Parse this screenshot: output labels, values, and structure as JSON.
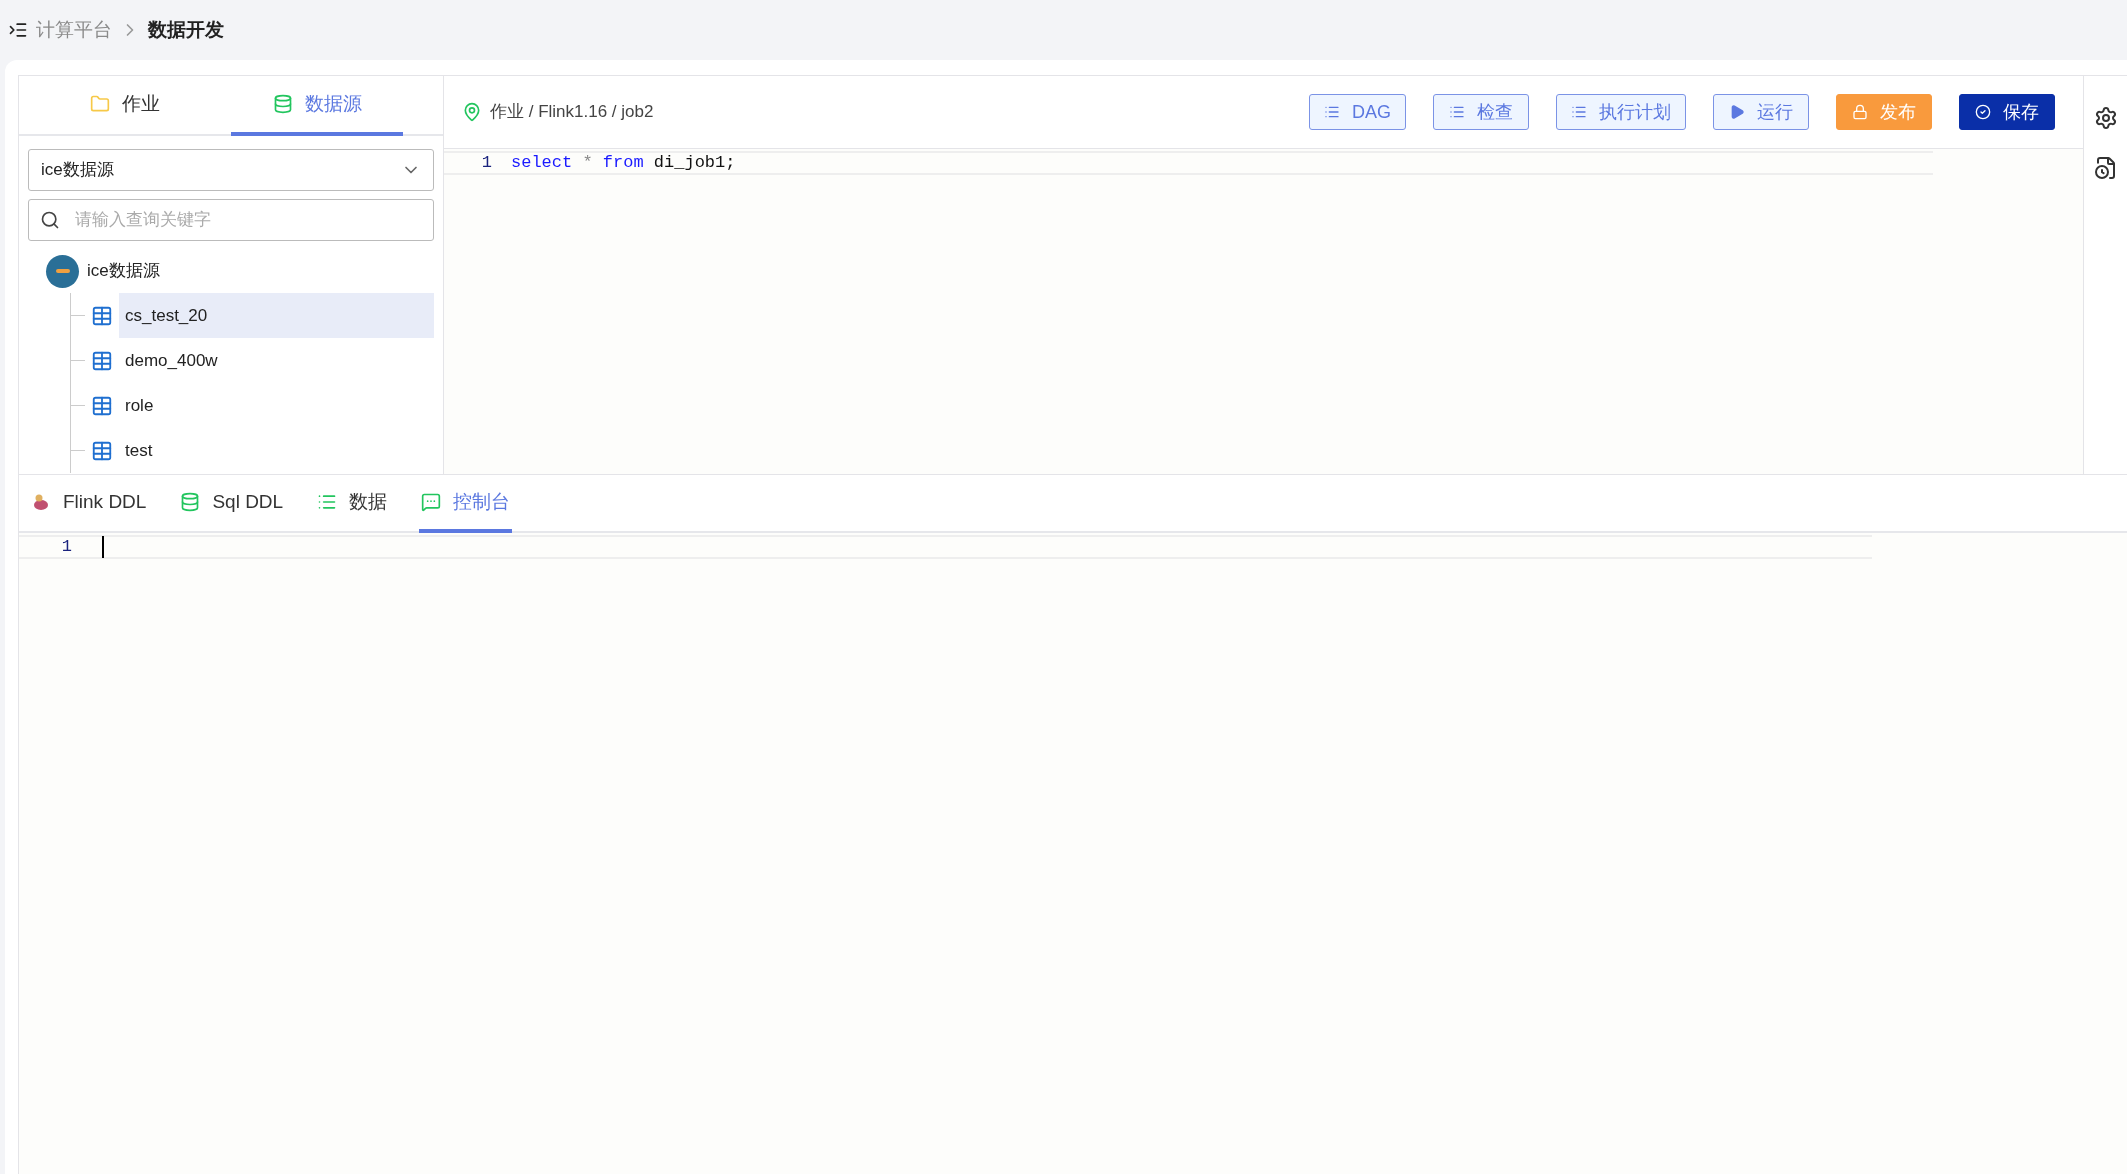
{
  "breadcrumb": {
    "items": [
      "计算平台",
      "数据开发"
    ]
  },
  "sidebar": {
    "tabs": [
      {
        "label": "作业",
        "kind": "folder",
        "selected": false
      },
      {
        "label": "数据源",
        "kind": "database",
        "selected": true
      }
    ],
    "source_select": {
      "value": "ice数据源"
    },
    "search": {
      "placeholder": "请输入查询关键字"
    },
    "tree": [
      {
        "label": "ice数据源",
        "children": [
          {
            "label": "cs_test_20",
            "selected": true
          },
          {
            "label": "demo_400w",
            "selected": false
          },
          {
            "label": "role",
            "selected": false
          },
          {
            "label": "test",
            "selected": false
          }
        ]
      }
    ]
  },
  "editor": {
    "path": "作业 / Flink1.16 / job2",
    "buttons": [
      {
        "label": "DAG",
        "kind": "list"
      },
      {
        "label": "检查",
        "kind": "list"
      },
      {
        "label": "执行计划",
        "kind": "list"
      },
      {
        "label": "运行",
        "kind": "run"
      },
      {
        "label": "发布",
        "kind": "publish"
      },
      {
        "label": "保存",
        "kind": "save"
      }
    ],
    "lines": [
      {
        "number": "1",
        "tokens": [
          {
            "text": "select",
            "kind": "keyword"
          },
          {
            "text": " * ",
            "kind": "operator"
          },
          {
            "text": "from",
            "kind": "keyword"
          },
          {
            "text": " di_job1;",
            "kind": "plain"
          }
        ]
      }
    ]
  },
  "bottom_panel": {
    "tabs": [
      {
        "label": "Flink DDL",
        "kind": "flink",
        "selected": false
      },
      {
        "label": "Sql DDL",
        "kind": "database",
        "selected": false
      },
      {
        "label": "数据",
        "kind": "list",
        "selected": false
      },
      {
        "label": "控制台",
        "kind": "console",
        "selected": true
      }
    ],
    "console_lines": [
      "1"
    ]
  }
}
